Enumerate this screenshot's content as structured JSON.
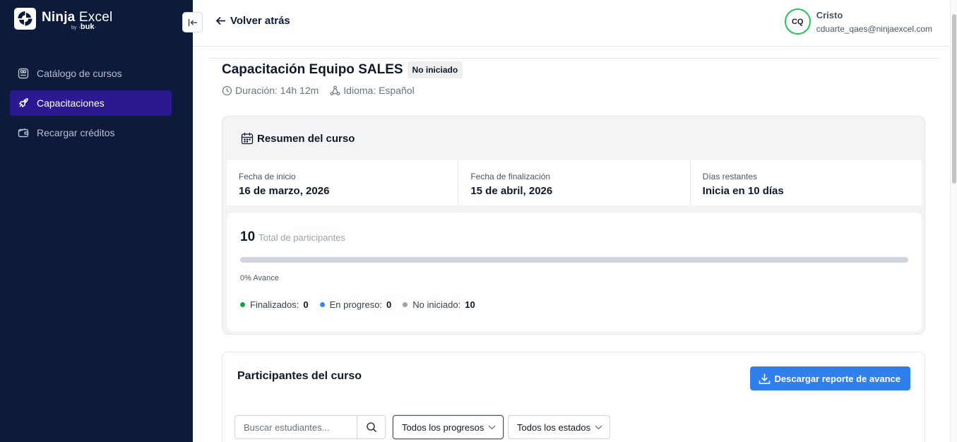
{
  "brand": {
    "name_bold": "Ninja",
    "name_light": " Excel",
    "by": "by",
    "sub": "buk"
  },
  "sidebar": {
    "items": [
      {
        "label": "Catálogo de cursos",
        "icon": "catalog-icon",
        "active": false
      },
      {
        "label": "Capacitaciones",
        "icon": "rocket-icon",
        "active": true
      },
      {
        "label": "Recargar créditos",
        "icon": "wallet-icon",
        "active": false
      }
    ]
  },
  "header": {
    "back_label": "Volver atrás",
    "user": {
      "initials": "CQ",
      "name": "Cristo",
      "email": "cduarte_qaes@ninjaexcel.com"
    }
  },
  "course": {
    "title": "Capacitación Equipo SALES",
    "status": "No iniciado",
    "duration": "Duración: 14h 12m",
    "language": "Idioma: Español"
  },
  "summary": {
    "title": "Resumen del curso",
    "start_label": "Fecha de inicio",
    "start_value": "16 de marzo, 2026",
    "end_label": "Fecha de finalización",
    "end_value": "15 de abril, 2026",
    "remaining_label": "Días restantes",
    "remaining_value": "Inicia en 10 días",
    "total_participants": "10",
    "total_label": "Total de participantes",
    "progress_percent": 0,
    "progress_text": "0% Avance",
    "legend": [
      {
        "label": "Finalizados:",
        "value": "0",
        "color": "#16a34a"
      },
      {
        "label": "En progreso:",
        "value": "0",
        "color": "#3b82f6"
      },
      {
        "label": "No iniciado:",
        "value": "10",
        "color": "#9ca3af"
      }
    ]
  },
  "participants": {
    "title": "Participantes del curso",
    "download_label": "Descargar reporte de avance",
    "search_placeholder": "Buscar estudiantes...",
    "progress_filter": "Todos los progresos",
    "status_filter": "Todos los estados"
  },
  "colors": {
    "sidebar_bg": "#0e1a3a",
    "active_item": "#2b1a8f",
    "primary_button": "#2f80ed",
    "avatar_ring": "#22c55e"
  }
}
